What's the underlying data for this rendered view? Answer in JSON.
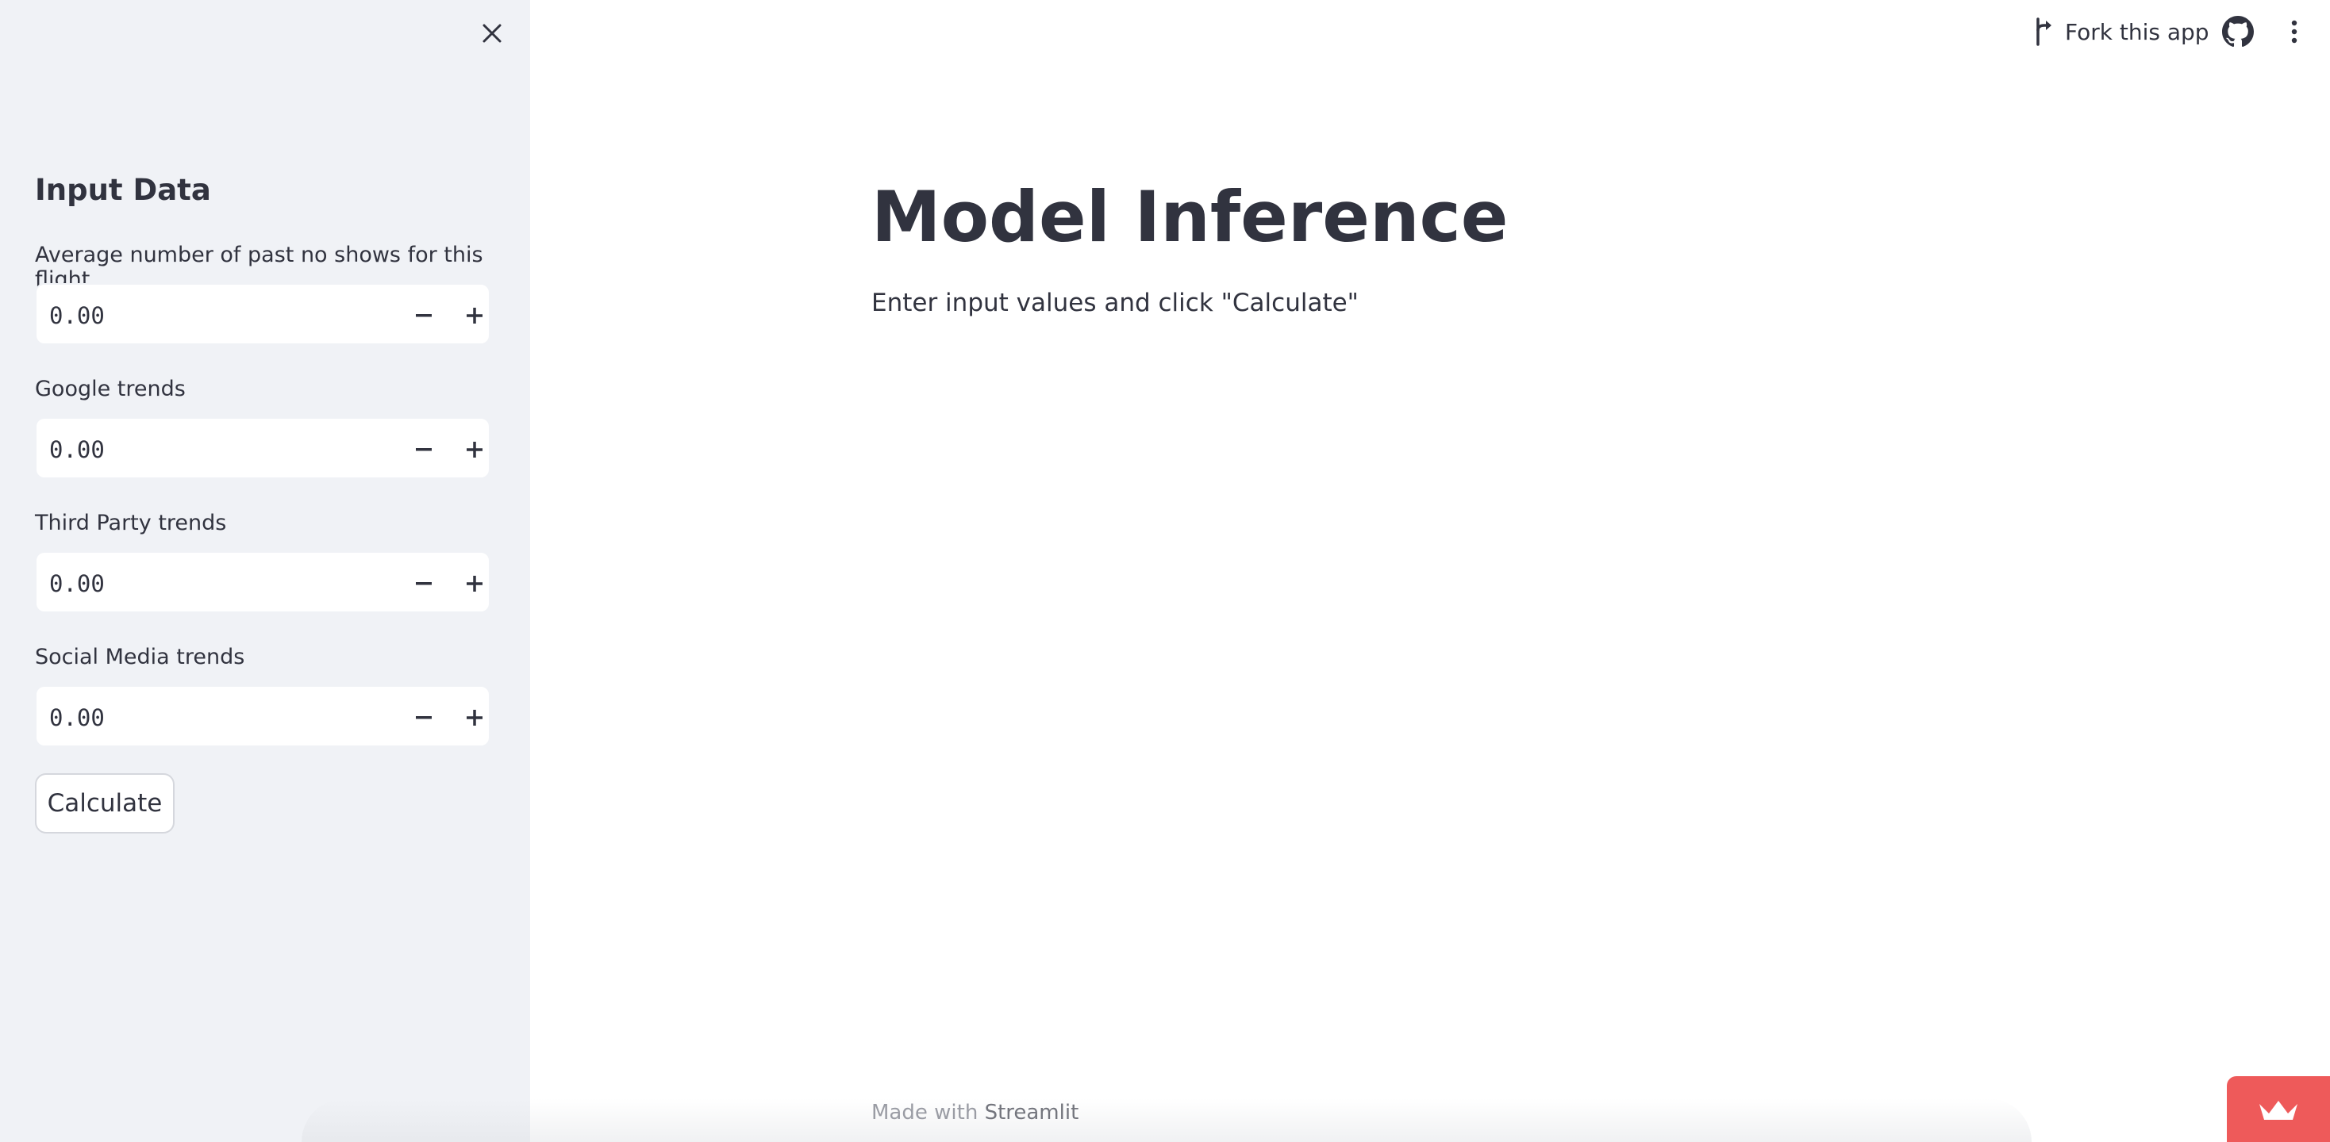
{
  "sidebar": {
    "title": "Input Data",
    "fields": [
      {
        "label": "Average number of past no shows for this flight",
        "value": "0.00"
      },
      {
        "label": "Google trends",
        "value": "0.00"
      },
      {
        "label": "Third Party trends",
        "value": "0.00"
      },
      {
        "label": "Social Media trends",
        "value": "0.00"
      }
    ],
    "button_label": "Calculate"
  },
  "header": {
    "fork_label": "Fork this app",
    "icons": [
      "close-icon",
      "fork-icon",
      "github-icon",
      "more-vertical-icon"
    ]
  },
  "main": {
    "title": "Model Inference",
    "description": "Enter input values and click \"Calculate\""
  },
  "footer": {
    "prefix": "Made with",
    "brand": "Streamlit"
  },
  "colors": {
    "sidebar_bg": "#f0f2f6",
    "text": "#31333f",
    "badge": "#ee5a5a"
  }
}
